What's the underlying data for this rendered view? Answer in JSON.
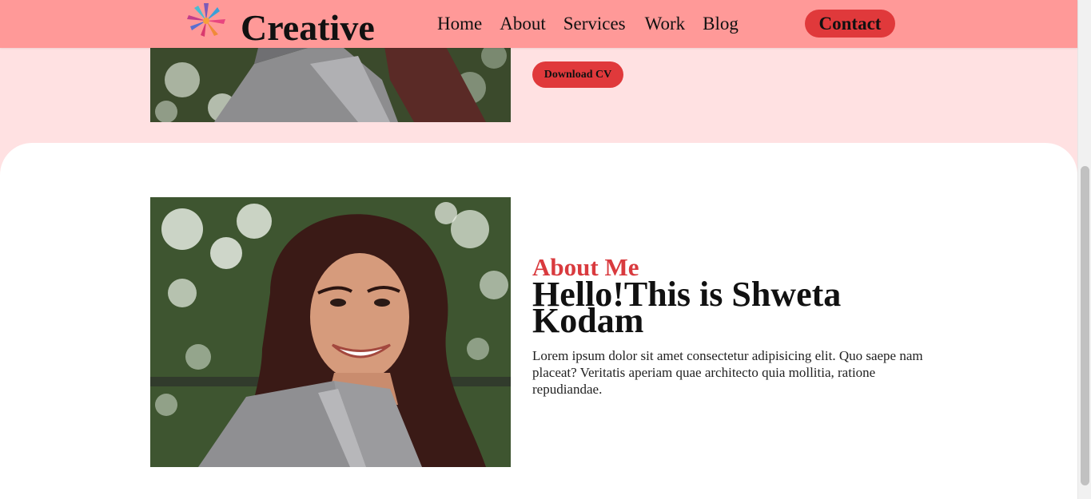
{
  "header": {
    "brand": "Creative",
    "nav": [
      "Home",
      "About",
      "Services",
      "Work",
      "Blog"
    ],
    "contact_label": "Contact"
  },
  "hero": {
    "download_label": "Download CV"
  },
  "about": {
    "kicker": "About Me",
    "title": "Hello!This is Shweta Kodam",
    "body": "Lorem ipsum dolor sit amet consectetur adipisicing elit. Quo saepe nam placeat? Veritatis aperiam quae architecto quia mollitia, ratione repudiandae."
  },
  "colors": {
    "header_bg": "#ff9998",
    "page_bg": "#ffe1e2",
    "accent": "#e0393b",
    "kicker": "#d93a3e"
  },
  "icons": [
    "flower-logo-icon"
  ]
}
